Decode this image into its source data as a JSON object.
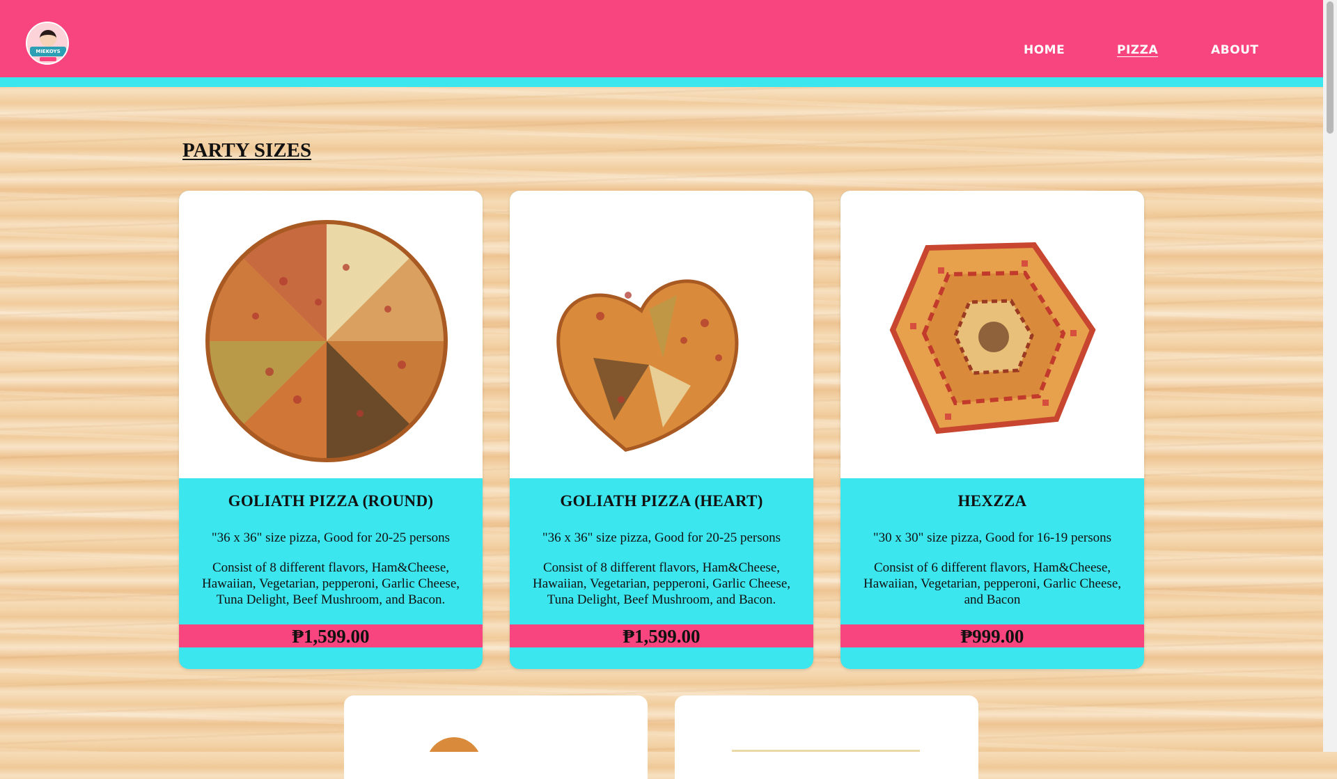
{
  "header": {
    "logo_text": "MIEKOYS",
    "nav": [
      {
        "label": "HOME"
      },
      {
        "label": "PIZZA"
      },
      {
        "label": "ABOUT"
      }
    ],
    "colors": {
      "brand_pink": "#f8457f",
      "accent_cyan": "#3ce6ee"
    }
  },
  "section": {
    "title": "PARTY SIZES"
  },
  "products": [
    {
      "name": "GOLIATH PIZZA (ROUND)",
      "size": "\"36 x 36\" size pizza, Good for 20-25 persons",
      "description": "Consist of 8 different flavors, Ham&Cheese, Hawaiian, Vegetarian, pepperoni, Garlic Cheese, Tuna Delight, Beef Mushroom, and Bacon.",
      "price": "₱1,599.00",
      "image_icon": "round-pizza-image"
    },
    {
      "name": "GOLIATH PIZZA (HEART)",
      "size": "\"36 x 36\" size pizza, Good for 20-25 persons",
      "description": "Consist of 8 different flavors, Ham&Cheese, Hawaiian, Vegetarian, pepperoni, Garlic Cheese, Tuna Delight, Beef Mushroom, and Bacon.",
      "price": "₱1,599.00",
      "image_icon": "heart-pizza-image"
    },
    {
      "name": "HEXZZA",
      "size": "\"30 x 30\" size pizza, Good for 16-19 persons",
      "description": "Consist of 6 different flavors, Ham&Cheese, Hawaiian, Vegetarian, pepperoni, Garlic Cheese, and Bacon",
      "price": "₱999.00",
      "image_icon": "hexagon-pizza-image"
    }
  ]
}
